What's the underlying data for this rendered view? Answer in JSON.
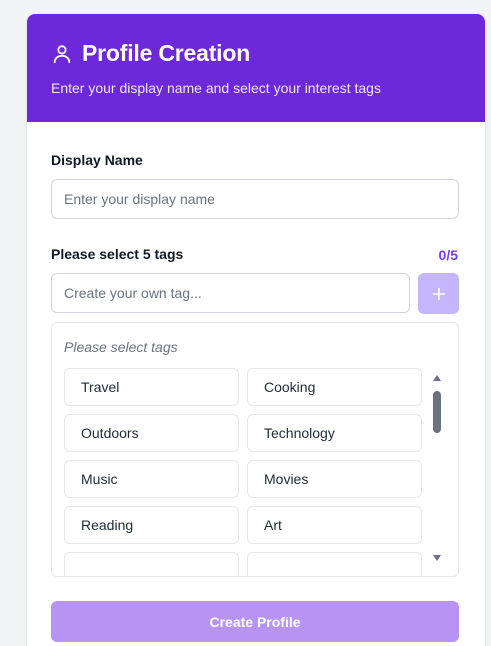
{
  "header": {
    "icon": "user-icon",
    "title": "Profile Creation",
    "subtitle": "Enter your display name and select your interest tags",
    "background": "#6d28d9"
  },
  "display_name": {
    "label": "Display Name",
    "placeholder": "Enter your display name",
    "value": ""
  },
  "tags": {
    "label": "Please select 5 tags",
    "counter": "0/5",
    "custom_placeholder": "Create your own tag...",
    "add_icon": "plus-icon",
    "hint": "Please select tags",
    "items": [
      "Travel",
      "Cooking",
      "Outdoors",
      "Technology",
      "Music",
      "Movies",
      "Reading",
      "Art",
      "",
      ""
    ]
  },
  "submit": {
    "label": "Create Profile",
    "background": "#b794f4"
  }
}
